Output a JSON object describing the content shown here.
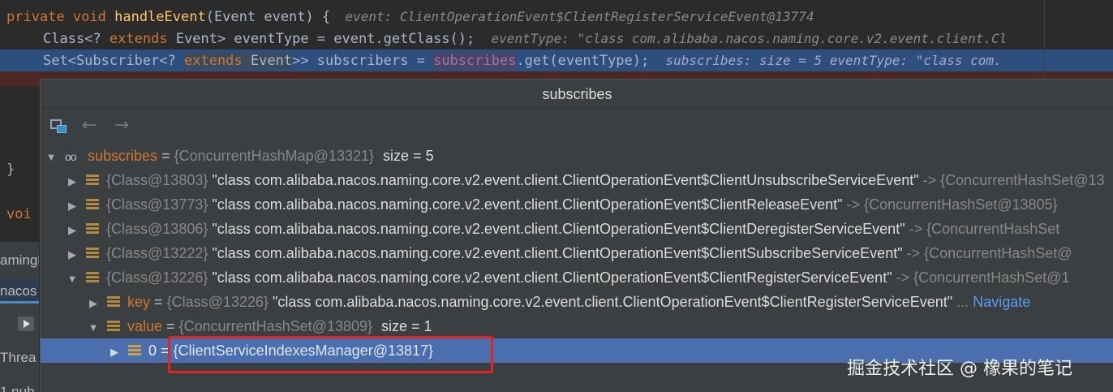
{
  "editor": {
    "line1": {
      "kw1": "private",
      "kw2": "void",
      "fn": "handleEvent",
      "sig": "(Event event) {",
      "hint": "event: ClientOperationEvent$ClientRegisterServiceEvent@13774"
    },
    "line2": {
      "pre": "Class<? ",
      "kw": "extends",
      "post": " Event> eventType = event.getClass();",
      "hint": "eventType: \"class com.alibaba.nacos.naming.core.v2.event.client.Cl"
    },
    "line3": {
      "pre": "Set<Subscriber<? ",
      "kw": "extends",
      "mid": " Event",
      "mid2": ">> subscribers = ",
      "field": "subscribes",
      "post": ".get(eventType);",
      "hint": "subscribes:  size = 5  eventType: \"class com."
    },
    "line_close": "}",
    "line_void": "voi"
  },
  "side": {
    "item1": "amingE",
    "item2": "nacos",
    "item3": "Threa",
    "item4": "1 nub"
  },
  "popup": {
    "title": "subscribes",
    "toolbar": {
      "back": "←",
      "forward": "→"
    }
  },
  "tree": {
    "root": {
      "name": "subscribes",
      "value": "{ConcurrentHashMap@13321}",
      "size": "size = 5"
    },
    "entries": [
      {
        "key": "{Class@13803}",
        "text": "\"class com.alibaba.nacos.naming.core.v2.event.client.ClientOperationEvent$ClientUnsubscribeServiceEvent\"",
        "arrow": "->",
        "value": "{ConcurrentHashSet@13"
      },
      {
        "key": "{Class@13773}",
        "text": "\"class com.alibaba.nacos.naming.core.v2.event.client.ClientOperationEvent$ClientReleaseEvent\"",
        "arrow": "->",
        "value": "{ConcurrentHashSet@13805}"
      },
      {
        "key": "{Class@13806}",
        "text": "\"class com.alibaba.nacos.naming.core.v2.event.client.ClientOperationEvent$ClientDeregisterServiceEvent\"",
        "arrow": "->",
        "value": "{ConcurrentHashSet"
      },
      {
        "key": "{Class@13222}",
        "text": "\"class com.alibaba.nacos.naming.core.v2.event.client.ClientOperationEvent$ClientSubscribeServiceEvent\"",
        "arrow": "->",
        "value": "{ConcurrentHashSet@"
      },
      {
        "key": "{Class@13226}",
        "text": "\"class com.alibaba.nacos.naming.core.v2.event.client.ClientOperationEvent$ClientRegisterServiceEvent\"",
        "arrow": "->",
        "value": "{ConcurrentHashSet@1"
      }
    ],
    "key_row": {
      "name": "key",
      "value": "{Class@13226}",
      "text": "\"class com.alibaba.nacos.naming.core.v2.event.client.ClientOperationEvent$ClientRegisterServiceEvent\"",
      "ellipsis": "...",
      "navigate": "Navigate"
    },
    "value_row": {
      "name": "value",
      "value": "{ConcurrentHashSet@13809}",
      "size": "size = 1"
    },
    "item_row": {
      "name": "0",
      "value": "{ClientServiceIndexesManager@13817}"
    }
  },
  "watermark": "掘金技术社区 @ 橡果的笔记"
}
